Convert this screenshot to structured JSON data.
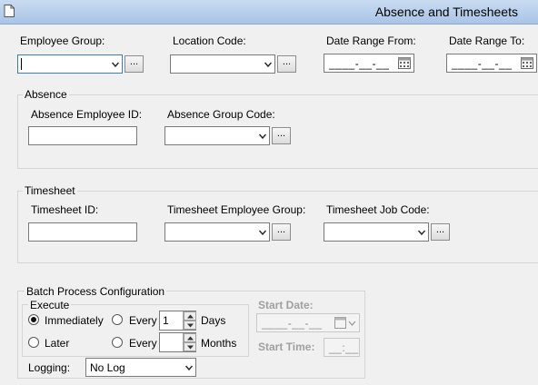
{
  "window": {
    "title": "Absence and Timesheets"
  },
  "filters": {
    "employee_group_label": "Employee Group:",
    "employee_group_value": "",
    "location_code_label": "Location Code:",
    "location_code_value": "",
    "date_from_label": "Date Range From:",
    "date_from_mask": "____-__-__",
    "date_to_label": "Date Range To:",
    "date_to_mask": "____-__-__",
    "browse_label": "..."
  },
  "absence": {
    "title": "Absence",
    "employee_id_label": "Absence Employee ID:",
    "employee_id_value": "",
    "group_code_label": "Absence Group Code:",
    "group_code_value": ""
  },
  "timesheet": {
    "title": "Timesheet",
    "id_label": "Timesheet ID:",
    "id_value": "",
    "employee_group_label": "Timesheet Employee Group:",
    "employee_group_value": "",
    "job_code_label": "Timesheet Job Code:",
    "job_code_value": ""
  },
  "batch": {
    "title": "Batch Process Configuration",
    "execute_title": "Execute",
    "immediately_label": "Immediately",
    "later_label": "Later",
    "every_label": "Every",
    "every_days_value": "1",
    "days_label": "Days",
    "every_months_value": "",
    "months_label": "Months",
    "start_date_label": "Start Date:",
    "start_date_mask": "____-__-__",
    "start_time_label": "Start Time:",
    "start_time_mask": "__:__",
    "logging_label": "Logging:",
    "logging_value": "No Log",
    "selected_option": "Immediately"
  }
}
